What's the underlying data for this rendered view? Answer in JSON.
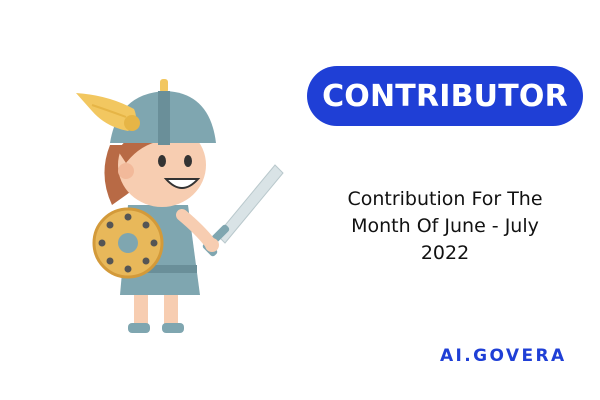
{
  "badge": {
    "label": "CONTRIBUTOR"
  },
  "subtitle": {
    "line1": "Contribution For The",
    "line2": "Month Of June - July",
    "line3": "2022"
  },
  "logo": {
    "text": "AI.GOVERA"
  },
  "colors": {
    "brand_blue": "#1f3fd6",
    "helmet": "#7fa6b0",
    "wing": "#f2c760",
    "shield": "#e8b85a",
    "tunic": "#7fa6b0",
    "hair": "#b86a45",
    "skin": "#f7cdb1"
  },
  "icons": {
    "character": "warrior-girl-illustration"
  }
}
